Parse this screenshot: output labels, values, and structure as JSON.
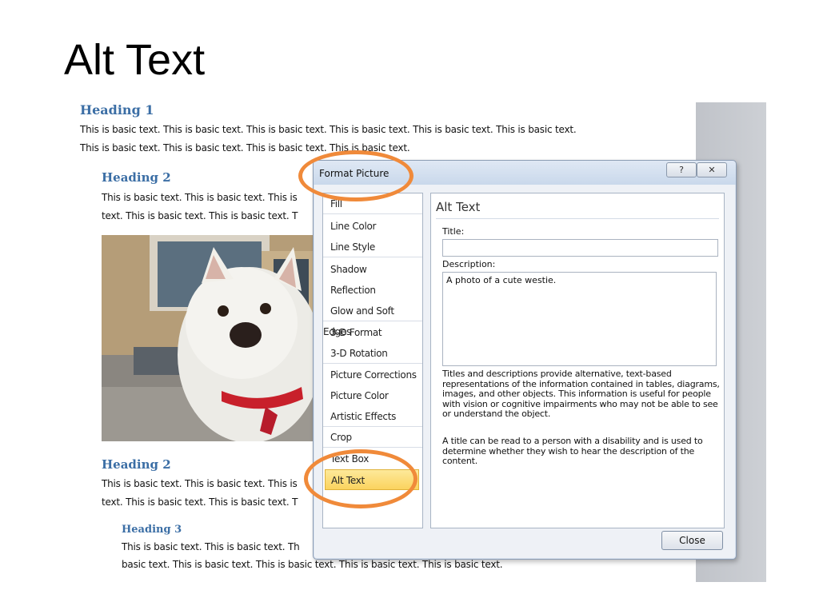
{
  "slide": {
    "title": "Alt Text"
  },
  "document": {
    "heading1": "Heading 1",
    "line1": "This is basic text. This is basic text. This is basic text. This is basic text. This is basic text. This is basic text.",
    "line2": "This is basic text. This is basic text. This is basic text. This is basic text.",
    "heading2a": "Heading 2",
    "line3": "This is basic text. This is basic text. This is",
    "line4": "text. This is basic text. This is basic text. T",
    "heading2b": "Heading 2",
    "line5": "This is basic text. This is basic text. This is",
    "line6": "text. This is basic text. This is basic text. T",
    "heading3": "Heading 3",
    "line7": "This is basic text. This is basic text. Th",
    "line8": "basic text. This is basic text. This is basic text. This is basic text. This is basic text."
  },
  "dialog": {
    "title": "Format Picture",
    "help_label": "?",
    "close_x_label": "✕",
    "nav_items": [
      "Fill",
      "Line Color",
      "Line Style",
      "Shadow",
      "Reflection",
      "Glow and Soft Edges",
      "3-D Format",
      "3-D Rotation",
      "Picture Corrections",
      "Picture Color",
      "Artistic Effects",
      "Crop",
      "Text Box",
      "Alt Text"
    ],
    "selected_item": "Alt Text",
    "panel_title": "Alt Text",
    "title_label": "Title:",
    "title_value": "",
    "description_label": "Description:",
    "description_value": "A photo of a cute westie.",
    "help_paragraph_1": "Titles and descriptions provide alternative, text-based representations of the information contained in tables, diagrams, images, and other objects. This information is useful for people with vision or cognitive impairments who may not be able to see or understand the object.",
    "help_paragraph_2": "A title can be read to a person with a disability and is used to determine whether they wish to hear the description of the content.",
    "close_button": "Close"
  },
  "colors": {
    "heading": "#3b6ea5",
    "highlight_ring": "#f08a3a",
    "selected_item": "#fbd35e"
  }
}
